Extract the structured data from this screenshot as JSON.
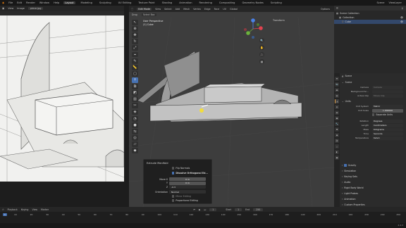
{
  "topbar": {
    "menus": [
      "File",
      "Edit",
      "Render",
      "Window",
      "Help"
    ],
    "workspaces": [
      "Layout",
      "Modeling",
      "Sculpting",
      "UV Editing",
      "Texture Paint",
      "Shading",
      "Animation",
      "Rendering",
      "Compositing",
      "Geometry Nodes",
      "Scripting"
    ],
    "active_workspace": "Layout",
    "scene_label": "Scene",
    "view_layer_label": "ViewLayer"
  },
  "image_editor": {
    "menus": [
      "View",
      "Image"
    ],
    "image_name": "piece.jpg"
  },
  "viewport": {
    "mode": "Edit Mode",
    "menus": [
      "View",
      "Select",
      "Add",
      "Mesh",
      "Vertex",
      "Edge",
      "Face",
      "UV"
    ],
    "sub_items": [
      "Drag",
      "Select Box"
    ],
    "global_label": "Global",
    "title_line1": "User Perspective",
    "title_line2": "(1) Cube",
    "options_label": "Options",
    "transform_label": "Transform"
  },
  "operator_panel": {
    "title": "Extrude Manifold",
    "flip_normals": "Flip Normals",
    "dissolve": "Dissolve Orthogonal Ed...",
    "move_x": "Move X",
    "move_y": "Y",
    "move_z": "Z",
    "move_x_val": "0 m",
    "move_y_val": "0 m",
    "move_z_val": "-0.3",
    "orientation_label": "Orientation",
    "orientation_val": "Normal",
    "editing": "Mirror Editing",
    "proportional": "Proportional Editing"
  },
  "outliner": {
    "header": "Scene Collection",
    "rows": [
      "Scene Collection",
      "Collection",
      "Cube"
    ],
    "search_placeholder": ""
  },
  "properties": {
    "scene_name": "Scene",
    "scene_section": "Scene",
    "camera_label": "Camera",
    "camera_val": "Camera",
    "background_label": "Background Sc...",
    "active_clip_label": "Active Clip",
    "active_clip_val": "Movie Clip",
    "units_section": "Units",
    "unit_system_label": "Unit System",
    "unit_system_val": "Metric",
    "unit_scale_label": "Unit Scale",
    "unit_scale_val": "1.000000",
    "separate_units": "Separate Units",
    "rotation_label": "Rotation",
    "rotation_val": "Degrees",
    "length_label": "Length",
    "length_val": "Centimeters",
    "mass_label": "Mass",
    "mass_val": "Kilograms",
    "time_label": "Time",
    "time_val": "Seconds",
    "temperature_label": "Temperature",
    "temperature_val": "Kelvin",
    "collapsed": [
      "Gravity",
      "Simulation",
      "Keying Sets",
      "Audio",
      "Rigid Body World",
      "Light Probes",
      "Animation",
      "Custom Properties"
    ]
  },
  "timeline": {
    "menus": [
      "Playback",
      "Keying",
      "View",
      "Marker"
    ],
    "current_frame": "1",
    "start_label": "Start",
    "start_val": "1",
    "end_label": "End",
    "end_val": "250",
    "ticks": [
      "10",
      "20",
      "30",
      "40",
      "50",
      "60",
      "70",
      "80",
      "90",
      "100",
      "110",
      "120",
      "130",
      "140",
      "150",
      "160",
      "170",
      "180",
      "190",
      "200",
      "210",
      "220",
      "230",
      "240",
      "250"
    ]
  },
  "status": {
    "version": "4.4.3"
  },
  "colors": {
    "accent": "#4772b3",
    "selection_orange": "#e2a149",
    "playhead": "#4772b3"
  }
}
